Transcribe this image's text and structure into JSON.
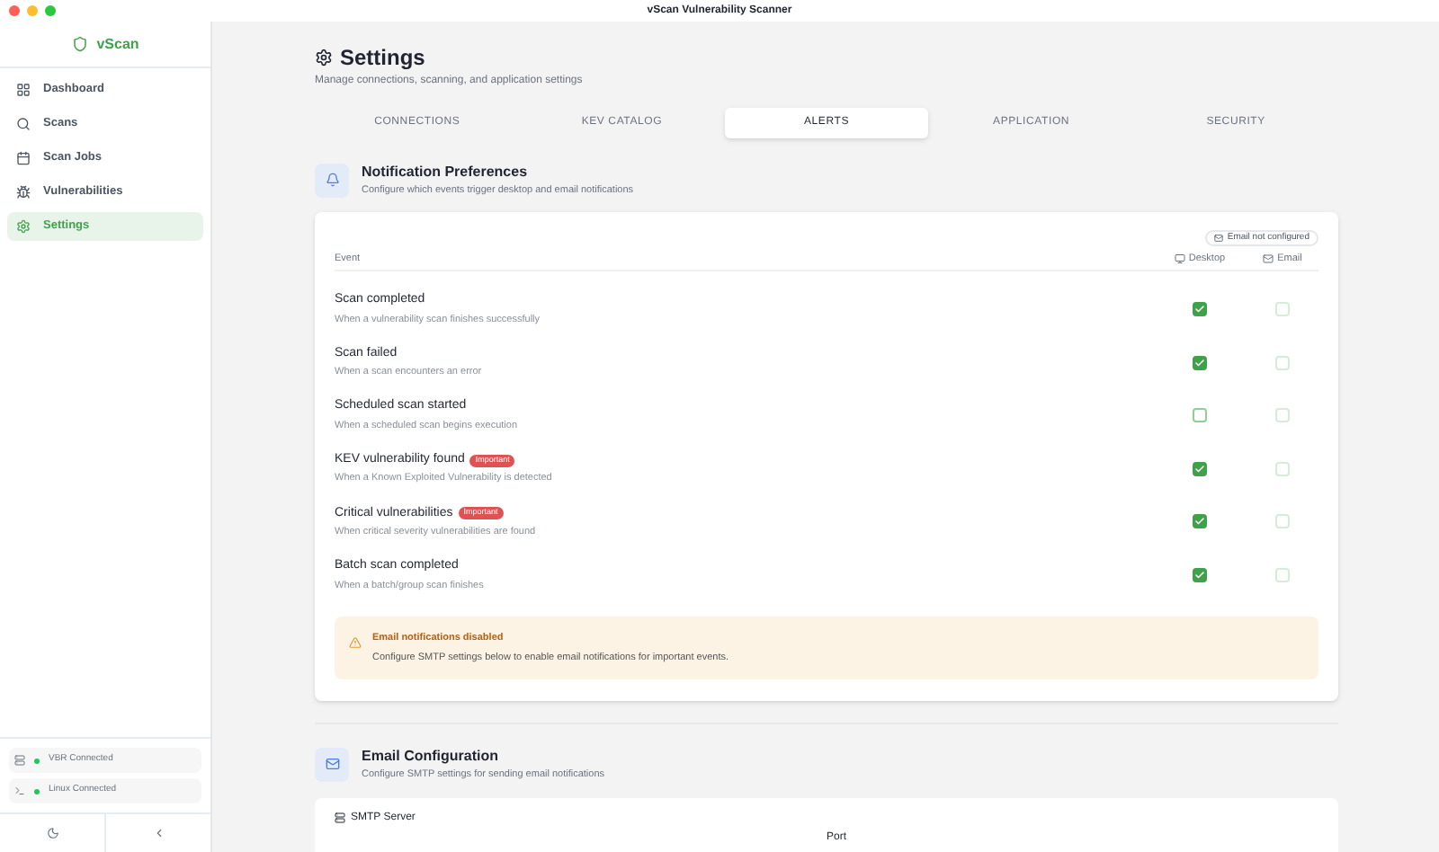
{
  "window": {
    "title": "vScan Vulnerability Scanner"
  },
  "sidebar": {
    "brand": "vScan",
    "items": [
      {
        "label": "Dashboard",
        "selected": false
      },
      {
        "label": "Scans",
        "selected": false
      },
      {
        "label": "Scan Jobs",
        "selected": false
      },
      {
        "label": "Vulnerabilities",
        "selected": false
      },
      {
        "label": "Settings",
        "selected": true
      }
    ],
    "connections": [
      {
        "label": "VBR Connected",
        "color": "#22c55e"
      },
      {
        "label": "Linux Connected",
        "color": "#22c55e"
      }
    ]
  },
  "page": {
    "title": "Settings",
    "subtitle": "Manage connections, scanning, and application settings"
  },
  "tabs": [
    {
      "label": "CONNECTIONS",
      "selected": false
    },
    {
      "label": "KEV CATALOG",
      "selected": false
    },
    {
      "label": "ALERTS",
      "selected": true
    },
    {
      "label": "APPLICATION",
      "selected": false
    },
    {
      "label": "SECURITY",
      "selected": false
    }
  ],
  "notifications": {
    "title": "Notification Preferences",
    "subtitle": "Configure which events trigger desktop and email notifications",
    "email_status": "Email not configured",
    "columns": [
      "Event",
      "Desktop",
      "Email"
    ],
    "events": [
      {
        "name": "Scan completed",
        "description": "When a vulnerability scan finishes successfully",
        "desktop": true,
        "email": false
      },
      {
        "name": "Scan failed",
        "description": "When a scan encounters an error",
        "desktop": true,
        "email": false
      },
      {
        "name": "Scheduled scan started",
        "description": "When a scheduled scan begins execution",
        "desktop": false,
        "email": false
      },
      {
        "name": "KEV vulnerability found",
        "badge": "Important",
        "description": "When a Known Exploited Vulnerability is detected",
        "desktop": true,
        "email": false
      },
      {
        "name": "Critical vulnerabilities",
        "badge": "Important",
        "description": "When critical severity vulnerabilities are found",
        "desktop": true,
        "email": false
      },
      {
        "name": "Batch scan completed",
        "description": "When a batch/group scan finishes",
        "desktop": true,
        "email": false
      }
    ],
    "warning": {
      "title": "Email notifications disabled",
      "text": "Configure SMTP settings below to enable email notifications for important events."
    }
  },
  "email_config": {
    "title": "Email Configuration",
    "subtitle": "Configure SMTP settings for sending email notifications",
    "fields": [
      "SMTP Server",
      "Port"
    ]
  }
}
